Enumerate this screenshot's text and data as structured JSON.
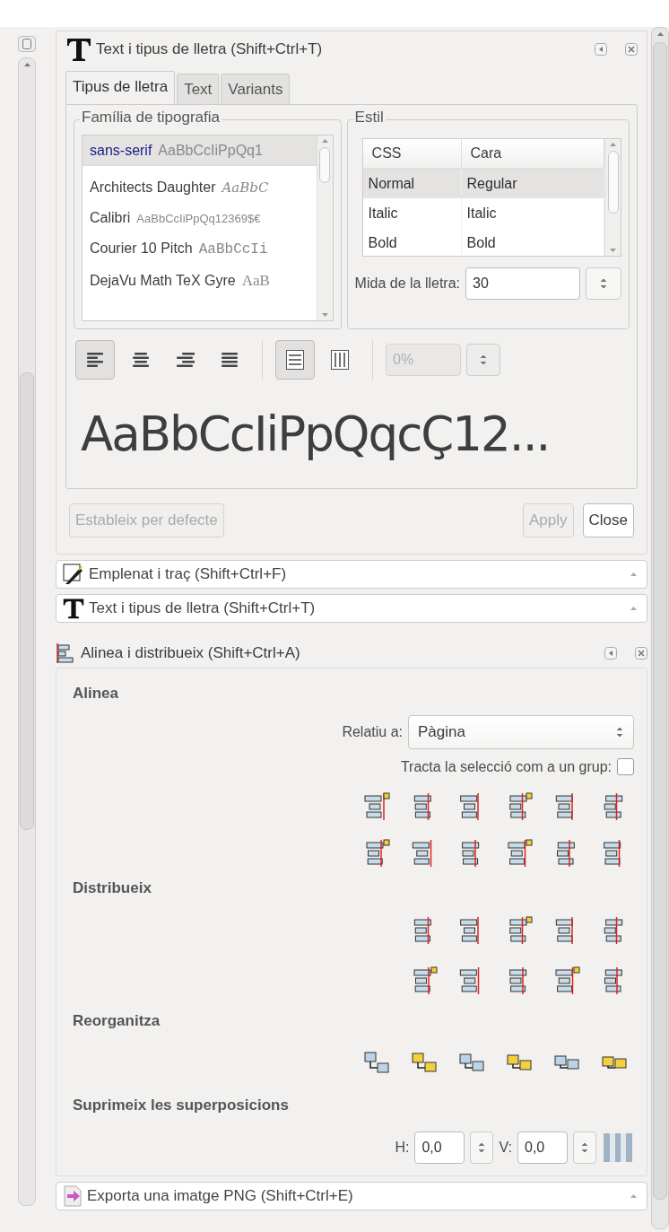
{
  "text_dialog": {
    "title": "Text i tipus de lletra (Shift+Ctrl+T)",
    "tabs": [
      {
        "label": "Tipus de lletra",
        "selected": true
      },
      {
        "label": "Text",
        "selected": false
      },
      {
        "label": "Variants",
        "selected": false
      }
    ],
    "family": {
      "legend": "Família de tipografia",
      "fonts": [
        {
          "name": "sans-serif",
          "sample": "AaBbCcIiPpQq1",
          "kind": "sans",
          "selected": true
        },
        {
          "name": "Architects Daughter",
          "sample": "AaBbC",
          "kind": "hand",
          "selected": false
        },
        {
          "name": "Calibri",
          "sample": "AaBbCcIiPpQq12369$€",
          "kind": "small",
          "selected": false
        },
        {
          "name": "Courier 10 Pitch",
          "sample": "AaBbCcIi",
          "kind": "mono",
          "selected": false
        },
        {
          "name": "DejaVu Math TeX Gyre",
          "sample": "AaB",
          "kind": "serif",
          "selected": false
        }
      ]
    },
    "style": {
      "legend": "Estil",
      "columns": [
        "CSS",
        "Cara"
      ],
      "rows": [
        {
          "css": "Normal",
          "face": "Regular",
          "selected": true
        },
        {
          "css": "Italic",
          "face": "Italic",
          "selected": false
        },
        {
          "css": "Bold",
          "face": "Bold",
          "selected": false
        }
      ],
      "size_label": "Mida de la lletra:",
      "size_value": "30"
    },
    "alignment_buttons": [
      {
        "kind": "left",
        "selected": true
      },
      {
        "kind": "center",
        "selected": false
      },
      {
        "kind": "right",
        "selected": false
      },
      {
        "kind": "justify",
        "selected": false
      }
    ],
    "orientation_buttons": [
      {
        "kind": "horizontal",
        "selected": true
      },
      {
        "kind": "vertical",
        "selected": false
      }
    ],
    "spacing": {
      "value": "0%",
      "disabled": true
    },
    "preview": "AaBbCcIiPpQqcÇ12...",
    "buttons": [
      {
        "label": "Estableix per defecte",
        "disabled": true
      },
      {
        "label": "Apply",
        "disabled": true
      },
      {
        "label": "Close",
        "disabled": false
      }
    ]
  },
  "collapsed_panels": [
    {
      "kind": "fill",
      "title": "Emplenat i traç (Shift+Ctrl+F)"
    },
    {
      "kind": "text",
      "title": "Text i tipus de lletra (Shift+Ctrl+T)"
    }
  ],
  "align_dialog": {
    "title": "Alinea i distribueix (Shift+Ctrl+A)",
    "align": {
      "heading": "Alinea",
      "relative_label": "Relatiu a:",
      "relative_value": "Pàgina",
      "group_label": "Tracta la selecció com a un grup:",
      "group_checked": false
    },
    "distribute": {
      "heading": "Distribueix"
    },
    "rearrange": {
      "heading": "Reorganitza"
    },
    "overlap": {
      "heading": "Suprimeix les superposicions",
      "h_label": "H:",
      "h_value": "0,0",
      "v_label": "V:",
      "v_value": "0,0"
    }
  },
  "export_panel": {
    "kind": "export",
    "title": "Exporta una imatge PNG (Shift+Ctrl+E)"
  }
}
